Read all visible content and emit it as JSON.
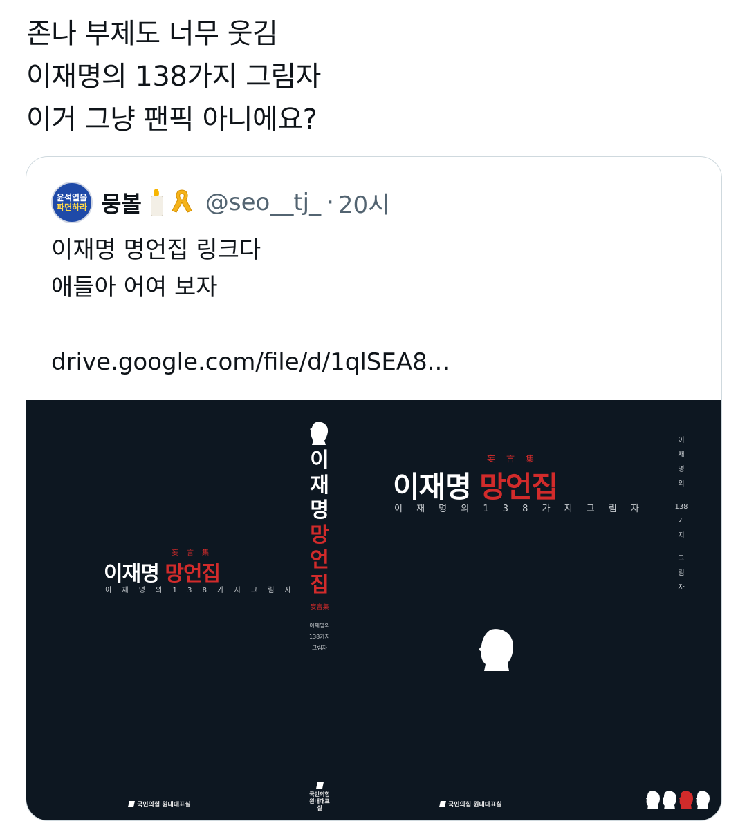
{
  "tweet": {
    "lines": [
      "존나 부제도 너무 웃김",
      "이재명의 138가지 그림자",
      "이거 그냥 팬픽 아니에요?"
    ]
  },
  "quote": {
    "avatar_text": [
      "윤석열을",
      "파면하라"
    ],
    "display_name": "뭉볼",
    "handle": "@seo__tj_",
    "separator": "·",
    "time": "20시",
    "body_lines": [
      "이재명 명언집 링크다",
      "애들아 어여 보자"
    ],
    "link": "drive.google.com/file/d/1qlSEA8..."
  },
  "cover": {
    "title_white": "이재명",
    "title_red": "망언집",
    "hanja": "妄言集",
    "subtitle": "이 재 명 의  1 3 8 가 지  그 림 자",
    "spine_chars": [
      "이",
      "재",
      "명",
      "망",
      "언",
      "집"
    ],
    "spine_sub": [
      "이재명의",
      "138가지",
      "그림자"
    ],
    "right_col": [
      "이",
      "재",
      "명",
      "의",
      "138",
      "가",
      "지",
      "그",
      "림",
      "자"
    ],
    "publisher": "국민의힘 원내대표실",
    "spine_publisher": [
      "국민의힘",
      "원내대표실"
    ]
  },
  "colors": {
    "cover_bg": "#0d1721",
    "accent_red": "#d12b2b",
    "handle_gray": "#536471",
    "border": "#cfd9de"
  }
}
